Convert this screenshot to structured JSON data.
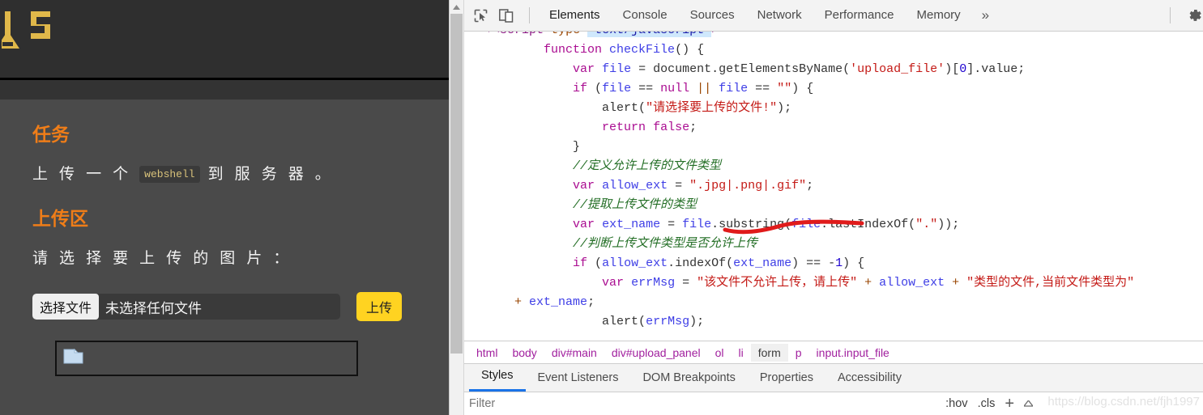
{
  "page": {
    "logo_alt": "site-logo",
    "task_heading": "任务",
    "task_text_before": "上 传 一 个",
    "task_code_chip": "webshell",
    "task_text_after": "到 服 务 器 。",
    "upload_heading": "上传区",
    "upload_prompt": "请 选 择 要 上 传 的 图 片 ：",
    "choose_file_label": "选择文件",
    "file_name_value": "未选择任何文件",
    "upload_button_label": "上传",
    "colors": {
      "heading": "#ef7d18",
      "upload_button_bg": "#ffd321",
      "page_bg": "#4a4a4a",
      "header_bg": "#2f2f2f",
      "logo": "#e0b84a"
    }
  },
  "devtools": {
    "toolbar": {
      "inspect_icon": "inspect-cursor-icon",
      "device_icon": "device-toolbar-icon",
      "settings_icon": "gear-icon",
      "more_label": "»",
      "tabs": [
        {
          "label": "Elements",
          "active": true
        },
        {
          "label": "Console",
          "active": false
        },
        {
          "label": "Sources",
          "active": false
        },
        {
          "label": "Network",
          "active": false
        },
        {
          "label": "Performance",
          "active": false
        },
        {
          "label": "Memory",
          "active": false
        }
      ]
    },
    "code": {
      "lines": [
        [
          {
            "t": "▾<",
            "c": "tok-tag"
          },
          {
            "t": "script",
            "c": "tok-tag"
          },
          {
            "t": " type",
            "c": "tok-attr"
          },
          {
            "t": "=",
            "c": "tok-plain"
          },
          {
            "t": "\"text/javascript\"",
            "c": "tok-val tok-sel"
          },
          {
            "t": ">",
            "c": "tok-tag"
          }
        ],
        [
          {
            "t": "        ",
            "c": "tok-plain"
          },
          {
            "t": "function",
            "c": "tok-kw"
          },
          {
            "t": " ",
            "c": "tok-plain"
          },
          {
            "t": "checkFile",
            "c": "tok-fn"
          },
          {
            "t": "() {",
            "c": "tok-plain"
          }
        ],
        [
          {
            "t": "            ",
            "c": "tok-plain"
          },
          {
            "t": "var",
            "c": "tok-kw"
          },
          {
            "t": " ",
            "c": "tok-plain"
          },
          {
            "t": "file",
            "c": "tok-fn"
          },
          {
            "t": " = document.",
            "c": "tok-plain"
          },
          {
            "t": "getElementsByName",
            "c": "tok-plain"
          },
          {
            "t": "(",
            "c": "tok-plain"
          },
          {
            "t": "'upload_file'",
            "c": "tok-str"
          },
          {
            "t": ")[",
            "c": "tok-plain"
          },
          {
            "t": "0",
            "c": "tok-num"
          },
          {
            "t": "].value;",
            "c": "tok-plain"
          }
        ],
        [
          {
            "t": "            ",
            "c": "tok-plain"
          },
          {
            "t": "if",
            "c": "tok-kw"
          },
          {
            "t": " (",
            "c": "tok-plain"
          },
          {
            "t": "file",
            "c": "tok-fn"
          },
          {
            "t": " == ",
            "c": "tok-plain"
          },
          {
            "t": "null",
            "c": "tok-kw"
          },
          {
            "t": " ",
            "c": "tok-plain"
          },
          {
            "t": "||",
            "c": "tok-op"
          },
          {
            "t": " ",
            "c": "tok-plain"
          },
          {
            "t": "file",
            "c": "tok-fn"
          },
          {
            "t": " == ",
            "c": "tok-plain"
          },
          {
            "t": "\"\"",
            "c": "tok-str"
          },
          {
            "t": ") {",
            "c": "tok-plain"
          }
        ],
        [
          {
            "t": "                ",
            "c": "tok-plain"
          },
          {
            "t": "alert",
            "c": "tok-plain"
          },
          {
            "t": "(",
            "c": "tok-plain"
          },
          {
            "t": "\"请选择要上传的文件!\"",
            "c": "tok-str"
          },
          {
            "t": ");",
            "c": "tok-plain"
          }
        ],
        [
          {
            "t": "                ",
            "c": "tok-plain"
          },
          {
            "t": "return",
            "c": "tok-kw"
          },
          {
            "t": " ",
            "c": "tok-plain"
          },
          {
            "t": "false",
            "c": "tok-kw"
          },
          {
            "t": ";",
            "c": "tok-plain"
          }
        ],
        [
          {
            "t": "            }",
            "c": "tok-plain"
          }
        ],
        [
          {
            "t": "            ",
            "c": "tok-plain"
          },
          {
            "t": "//定义允许上传的文件类型",
            "c": "tok-com"
          }
        ],
        [
          {
            "t": "            ",
            "c": "tok-plain"
          },
          {
            "t": "var",
            "c": "tok-kw"
          },
          {
            "t": " ",
            "c": "tok-plain"
          },
          {
            "t": "allow_ext",
            "c": "tok-fn"
          },
          {
            "t": " = ",
            "c": "tok-plain"
          },
          {
            "t": "\".jpg|.png|.gif\"",
            "c": "tok-str"
          },
          {
            "t": ";",
            "c": "tok-plain"
          }
        ],
        [
          {
            "t": "            ",
            "c": "tok-plain"
          },
          {
            "t": "//提取上传文件的类型",
            "c": "tok-com"
          }
        ],
        [
          {
            "t": "            ",
            "c": "tok-plain"
          },
          {
            "t": "var",
            "c": "tok-kw"
          },
          {
            "t": " ",
            "c": "tok-plain"
          },
          {
            "t": "ext_name",
            "c": "tok-fn"
          },
          {
            "t": " = ",
            "c": "tok-plain"
          },
          {
            "t": "file",
            "c": "tok-fn"
          },
          {
            "t": ".substring(",
            "c": "tok-plain"
          },
          {
            "t": "file",
            "c": "tok-fn"
          },
          {
            "t": ".lastIndexOf(",
            "c": "tok-plain"
          },
          {
            "t": "\".\"",
            "c": "tok-str"
          },
          {
            "t": "));",
            "c": "tok-plain"
          }
        ],
        [
          {
            "t": "            ",
            "c": "tok-plain"
          },
          {
            "t": "//判断上传文件类型是否允许上传",
            "c": "tok-com"
          }
        ],
        [
          {
            "t": "            ",
            "c": "tok-plain"
          },
          {
            "t": "if",
            "c": "tok-kw"
          },
          {
            "t": " (",
            "c": "tok-plain"
          },
          {
            "t": "allow_ext",
            "c": "tok-fn"
          },
          {
            "t": ".indexOf(",
            "c": "tok-plain"
          },
          {
            "t": "ext_name",
            "c": "tok-fn"
          },
          {
            "t": ") == -",
            "c": "tok-plain"
          },
          {
            "t": "1",
            "c": "tok-num"
          },
          {
            "t": ") {",
            "c": "tok-plain"
          }
        ],
        [
          {
            "t": "                ",
            "c": "tok-plain"
          },
          {
            "t": "var",
            "c": "tok-kw"
          },
          {
            "t": " ",
            "c": "tok-plain"
          },
          {
            "t": "errMsg",
            "c": "tok-fn"
          },
          {
            "t": " = ",
            "c": "tok-plain"
          },
          {
            "t": "\"该文件不允许上传，请上传\"",
            "c": "tok-str"
          },
          {
            "t": " + ",
            "c": "tok-op"
          },
          {
            "t": "allow_ext",
            "c": "tok-fn"
          },
          {
            "t": " + ",
            "c": "tok-op"
          },
          {
            "t": "\"类型的文件,当前文件类型为\"",
            "c": "tok-str"
          }
        ],
        [
          {
            "t": "    ",
            "c": "tok-plain"
          },
          {
            "t": "+",
            "c": "tok-op"
          },
          {
            "t": " ",
            "c": "tok-plain"
          },
          {
            "t": "ext_name",
            "c": "tok-fn"
          },
          {
            "t": ";",
            "c": "tok-plain"
          }
        ],
        [
          {
            "t": "                ",
            "c": "tok-plain"
          },
          {
            "t": "alert",
            "c": "tok-plain"
          },
          {
            "t": "(",
            "c": "tok-plain"
          },
          {
            "t": "errMsg",
            "c": "tok-fn"
          },
          {
            "t": ");",
            "c": "tok-plain"
          }
        ]
      ],
      "annotation": "red-underline-stroke"
    },
    "breadcrumb": [
      {
        "label": "html",
        "selected": false
      },
      {
        "label": "body",
        "selected": false
      },
      {
        "label": "div#main",
        "selected": false
      },
      {
        "label": "div#upload_panel",
        "selected": false
      },
      {
        "label": "ol",
        "selected": false
      },
      {
        "label": "li",
        "selected": false
      },
      {
        "label": "form",
        "selected": true
      },
      {
        "label": "p",
        "selected": false
      },
      {
        "label": "input.input_file",
        "selected": false
      }
    ],
    "side_tabs": [
      {
        "label": "Styles",
        "active": true
      },
      {
        "label": "Event Listeners",
        "active": false
      },
      {
        "label": "DOM Breakpoints",
        "active": false
      },
      {
        "label": "Properties",
        "active": false
      },
      {
        "label": "Accessibility",
        "active": false
      }
    ],
    "filter": {
      "placeholder": "Filter",
      "value": "",
      "hov_label": ":hov",
      "cls_label": ".cls",
      "plus_label": "+",
      "caret_icon": "caret-up-icon"
    },
    "watermark": "https://blog.csdn.net/fjh1997",
    "accent_color": "#1a73e8"
  }
}
